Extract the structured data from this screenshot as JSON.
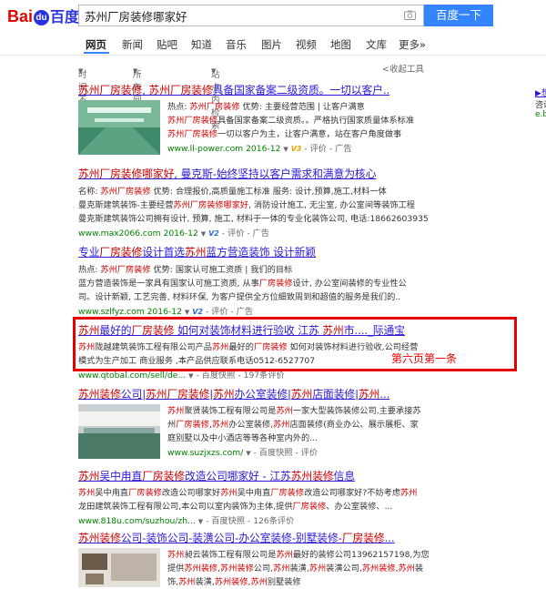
{
  "header": {
    "logo_text_1": "Bai",
    "logo_paw": "du",
    "logo_text_2": "百度",
    "search_value": "苏州厂房装修哪家好",
    "search_button": "百度一下"
  },
  "tabs": [
    "网页",
    "新闻",
    "贴吧",
    "知道",
    "音乐",
    "图片",
    "视频",
    "地图",
    "文库",
    "更多»"
  ],
  "tools": {
    "time": "时间不限",
    "filetype": "所有网页和文件",
    "site": "站点内检索",
    "collapse": "<收起工具"
  },
  "results": [
    {
      "title_parts": [
        "苏州厂房装修",
        ", ",
        "苏州厂房装修",
        "具备国家备案二级资质。一切以客户.."
      ],
      "lines": [
        "热点: 苏州厂房装修   优势: 主要经营范围 | 让客户满意",
        "苏州厂房装修具备国家备案二级资质。。严格执行国家质量体系标准",
        "苏州厂房装修一切以客户为主，让客户满意，站在客户角度做事"
      ],
      "url": "www.ll-power.com",
      "date": "2016-12",
      "v": "V3",
      "meta": " - 评价 - 广告"
    },
    {
      "title_parts": [
        "苏州厂房装修哪家好",
        ", 曼克斯-始终坚持以客户需求和满意为核心"
      ],
      "lines": [
        "名称: 苏州厂房装修    优势: 合理报价,高质量施工标准    服务: 设计,预算,施工,材料一体",
        "曼克斯建筑装饰-主要经营苏州厂房装修哪家好, 消防设计施工, 无尘室, 办公室间等装饰工程",
        "曼克斯建筑装饰公司拥有设计, 预算, 施工, 材料于一体的专业化装饰公司, 电话:18662603935"
      ],
      "url": "www.max2066.com",
      "date": "2016-12",
      "v": "V2",
      "meta": " - 评价 - 广告"
    },
    {
      "title_parts": [
        "专业厂房装修设计首选苏州蓝方营造装饰 设计新颖"
      ],
      "lines": [
        "热点: 苏州厂房装修    优势: 国家认可施工资质 | 我们的目标",
        "蓝方营造装饰是一家具有国家认可施工资质, 从事厂房装修设计, 办公室间装修的专业性公",
        "司。设计新颖, 工艺完善, 材料环保, 为客户提供全方位细致周到和超值的服务是我们的.."
      ],
      "url": "www.szlfyz.com",
      "date": "2016-12",
      "v": "V2",
      "meta": " - 评价 - 广告"
    },
    {
      "title_parts": [
        "苏州最好的厂房装修 如何对装饰材料进行验收 江苏 苏州市...._际通宝"
      ],
      "lines": [
        "苏州陇越建筑装饰工程有限公司产品苏州最好的厂房装修 如何对装饰材料进行验收,公司经营",
        "模式为生产加工 商业服务 ,本产品供应联系电话0512-6527707"
      ],
      "url": "www.qtobal.com/sell/de...",
      "date": "",
      "v": "",
      "meta": " - 百度快照 - 197条评价"
    },
    {
      "title_parts": [
        "苏州装修公司|苏州厂房装修|苏州办公室装修|苏州店面装修|苏州..."
      ],
      "lines": [
        "苏州聚贤装饰工程有限公司是苏州一家大型装饰装修公司,主要承接苏",
        "州厂房装修,苏州办公室装修,苏州店面装修(商业办公、展示展柜、家",
        "庭别墅以及中小酒店等等各种室内外的..."
      ],
      "url": "www.suzjxzs.com/",
      "date": "",
      "v": "",
      "meta": " - 百度快照 - 评价"
    },
    {
      "title_parts": [
        "苏州吴中甪直厂房装修改造公司哪家好 - 江苏苏州装修信息"
      ],
      "lines": [
        "苏州吴中甪直厂房装修改造公司哪家好苏州吴中甪直厂房装修改造公司哪家好?不妨考虑苏州",
        "龙田建筑装饰工程有限公司,本公司以室内装饰为主体,提供厂房装修、办公室装修、..."
      ],
      "url": "www.818u.com/suzhou/zh...",
      "date": "",
      "v": "",
      "meta": " - 百度快照 - 126条评价"
    },
    {
      "title_parts": [
        "苏州装修公司-装饰公司-装潢公司-办公室装修-别墅装修-厂房装修..."
      ],
      "lines": [
        "苏州昶云装饰工程有限公司是苏州最好的装修公司13962157198,为您",
        "提供苏州装修,苏州装修公司,苏州装潢,苏州装潢公司,苏州装修,苏州装",
        "饰,苏州装潢,苏州装修,苏州别墅装修"
      ],
      "url": "",
      "date": "",
      "v": "",
      "meta": ""
    }
  ],
  "annotation": "第六页第一条",
  "right_panel": [
    "▶想",
    "咨讯",
    "e.bai"
  ]
}
